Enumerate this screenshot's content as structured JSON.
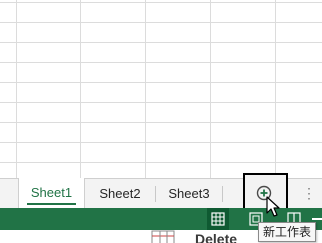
{
  "sheet_tabs": [
    {
      "label": "Sheet1",
      "active": true
    },
    {
      "label": "Sheet2",
      "active": false
    },
    {
      "label": "Sheet3",
      "active": false
    }
  ],
  "new_sheet_button": {
    "icon": "plus-circle-icon"
  },
  "tab_overflow": {
    "label": "⋮"
  },
  "status_bar": {
    "views": [
      "normal-view-icon",
      "page-layout-view-icon",
      "page-break-preview-icon"
    ],
    "active_view": "normal-view-icon"
  },
  "ribbon_fragment": {
    "label": "Delete"
  },
  "tooltip": {
    "text": "新工作表"
  },
  "colors": {
    "accent": "#217346",
    "accent_dark": "#0f5a32",
    "tabbar_bg": "#f3f3f3",
    "grid_line": "#dcdcdc"
  }
}
